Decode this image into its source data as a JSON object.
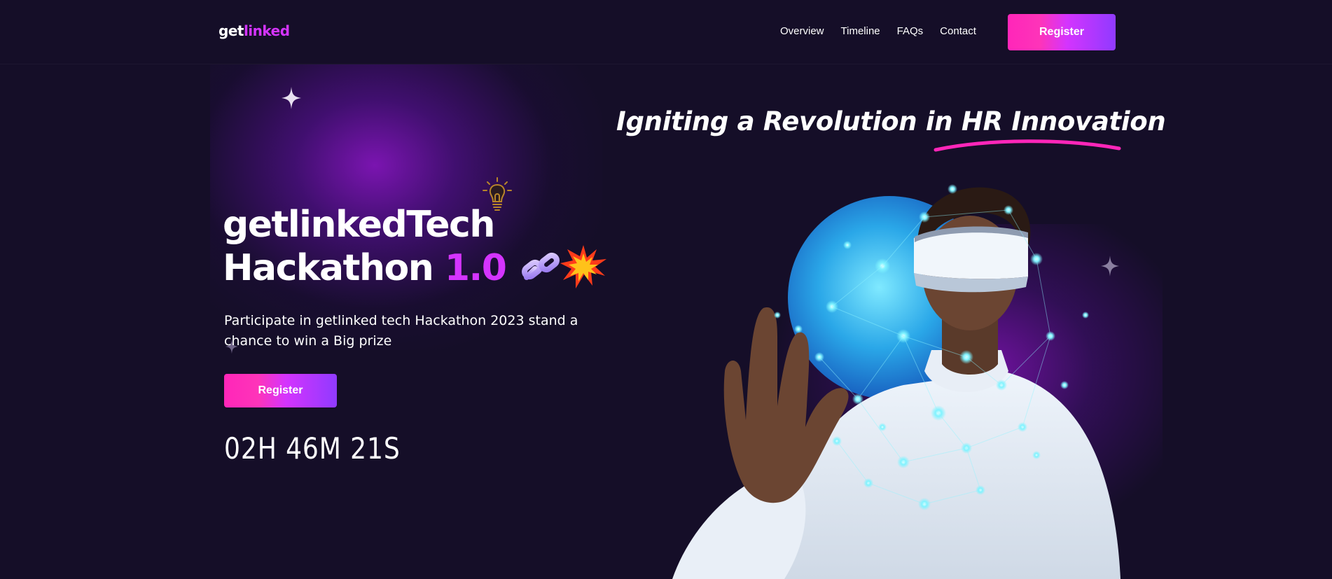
{
  "header": {
    "logo_part1": "get",
    "logo_part2": "linked",
    "nav": [
      {
        "label": "Overview"
      },
      {
        "label": "Timeline"
      },
      {
        "label": "FAQs"
      },
      {
        "label": "Contact"
      }
    ],
    "register_label": "Register"
  },
  "hero": {
    "tagline": "Igniting a Revolution in HR Innovation",
    "title_line1": "getlinkedTech",
    "title_line2_prefix": "Hackathon ",
    "title_version": "1.0",
    "subtitle": "Participate in getlinked tech Hackathon 2023 stand a chance to win a Big prize",
    "register_label": "Register",
    "countdown": {
      "hours": "02",
      "hours_unit": "H",
      "minutes": "46",
      "minutes_unit": "M",
      "seconds": "21",
      "seconds_unit": "S"
    }
  },
  "colors": {
    "background": "#150e28",
    "accent_purple": "#d434fe",
    "accent_pink": "#fe34b9",
    "gradient_end": "#903aff"
  }
}
